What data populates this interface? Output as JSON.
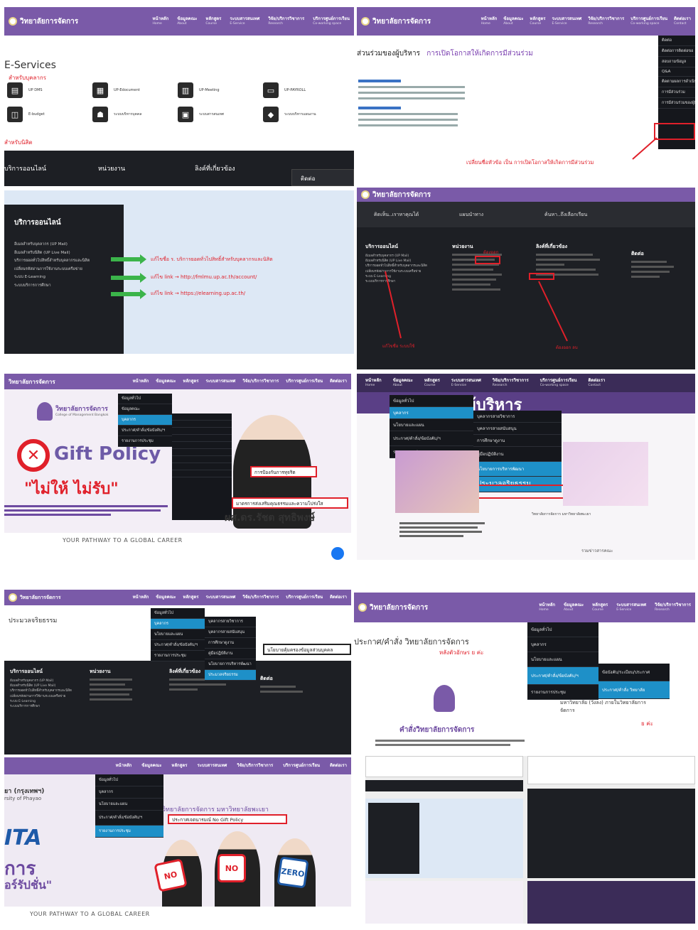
{
  "site": {
    "logo": "วิทยาลัยการจัดการ"
  },
  "nav": [
    {
      "th": "หน้าหลัก",
      "en": "Home"
    },
    {
      "th": "ข้อมูลคณะ",
      "en": "About"
    },
    {
      "th": "หลักสูตร",
      "en": "Course"
    },
    {
      "th": "ระบบสารสนเทศ",
      "en": "E-Service"
    },
    {
      "th": "วิจัย/บริการวิชาการ",
      "en": "Research"
    },
    {
      "th": "บริการศูนย์การเรียน",
      "en": "Co-working space"
    },
    {
      "th": "ติดต่อเรา",
      "en": "Contact"
    }
  ],
  "p1": {
    "title": "E-Services",
    "staff_label": "สำหรับบุคลากร",
    "student_label": "สำหรับนิสิต",
    "services": [
      "UP DMS",
      "UP-Edocument",
      "UP-Meeting",
      "UP-PAYROLL",
      "E-budget",
      "ระบบบริหารบุคคล",
      "ระบบสารสนเทศ",
      "ระบบบริหารแผนงาน"
    ],
    "footer": [
      "บริการออนไลน์",
      "หน่วยงาน",
      "ลิงค์ที่เกี่ยวข้อง",
      "ติดต่อ"
    ]
  },
  "p2": {
    "heading": "ส่วนร่วมของผู้บริหาร",
    "heading_accent": "การเปิดโอกาสให้เกิดการมีส่วนร่วม",
    "note": "เปลี่ยนชื่อหัวข้อ เป็น การเปิดโอกาสให้เกิดการมีส่วนร่วม",
    "menu": [
      "ติดต่อ",
      "ติดต่อการติดต่อขอ",
      "สอบถามข้อมูล",
      "Q&A",
      "ติดตามผลการดำเนินงาน",
      "การมีส่วนร่วม",
      "การมีส่วนร่วมของผู้มีส่วนได้"
    ]
  },
  "p3": {
    "title": "บริการออนไลน์",
    "items": [
      "อีเมลสำหรับบุคลากร (UP Mail)",
      "อีเมลสำหรับนิสิต (UP Live Mail)",
      "บริการยอดทั่วไปสิทธิ์สำหรับบุคลากรและนิสิต",
      "เปลี่ยนรหัสผ่านการใช้งานระบบเครือข่าย",
      "ระบบ E-Learning",
      "ระบบบริการการศึกษา"
    ],
    "fixes": [
      "แก้ไขชื่อ ร. บริการยอดทั่วไปสิทธิ์สำหรับบุคลากรและนิสิต",
      "แก้ไข link → http://fmlmu.up.ac.th/account/",
      "แก้ไข link → https://elearning.up.ac.th/"
    ]
  },
  "p4": {
    "tabs": [
      "คิดเห็น..เราหาคุณได้",
      "แผนนำทาง",
      "ค้นหา..ถึงเลือกเรียน"
    ],
    "cols": [
      "บริการออนไลน์",
      "หน่วยงาน",
      "ลิงค์ที่เกี่ยวข้อง",
      "ติดต่อ"
    ],
    "red_left": "แก้ไขชื่อ ระบบใช้",
    "red_right": "ต้องออก ลบ",
    "red_mid": "ต้องออก"
  },
  "p5": {
    "college_th": "วิทยาลัยการจัดการ",
    "college_sub": "College of Management Bangkok",
    "policy": "Gift Policy",
    "slogan": "\"ไม่ให้ ไม่รับ\"",
    "name": "ผศ.ดร.รัชต สุทธิพงษ์",
    "boxes": [
      "การป้องกันการทุจริต",
      "มาตรการส่งเสริมคุณธรรมและความโปร่งใส"
    ],
    "change_lbl": "เปลี่ยนชื่อ",
    "tagline": "YOUR PATHWAY TO A GLOBAL CAREER",
    "menu": [
      "ข้อมูลทั่วไป",
      "บุคลากร",
      "นโยบายและแผน",
      "ประกาศ/คำสั่ง/ข้อบังคับ/ฯ",
      "รายงานการประชุม"
    ]
  },
  "p6": {
    "banner": "ารงผู้บริหาร",
    "menu_l": [
      "ข้อมูลทั่วไป",
      "บุคลากร",
      "นโยบายและแผน",
      "ประกาศ/คำสั่ง/ข้อบังคับ/ฯ",
      "รายงานการประชุม"
    ],
    "menu_r": [
      "บุคลากรสายวิชาการ",
      "บุคลากรสายสนับสนุน",
      "การศึกษาดูงาน",
      "คู่มือปฏิบัติงาน",
      "นโยบายการบริหารพัฒนา",
      "ประมวลจริยธรรม"
    ],
    "news": "วิทยาลัยการจัดการ มหาวิทยาลัยพะเยา",
    "more": "รวมข่าวสารคณะ"
  },
  "p7": {
    "title": "ประมวลจริยธรรม",
    "box": "นโยบายคุ้มครองข้อมูลส่วนบุคคล",
    "cols": [
      "บริการออนไลน์",
      "หน่วยงาน",
      "ลิงค์ที่เกี่ยวข้อง",
      "ติดต่อ"
    ]
  },
  "p8": {
    "heading": "ประกาศ/คำสั่ง วิทยาลัยการจัดการ",
    "sub": "หลังตัวอักษร ย ค่ะ",
    "announce": "คำสั่งวิทยาลัยการจัดการ",
    "menu": [
      "ข้อมูลทั่วไป",
      "บุคลากร",
      "นโยบายและแผน",
      "ประกาศ/คำสั่ง/ข้อบังคับ/ฯ",
      "รายงานการประชุม"
    ],
    "submenu": [
      "ข้อบังคับ/ระเบียบ/ประกาศ",
      "ประกาศ/คำสั่ง วิทยาลัย"
    ],
    "side": "มหาวิทยาลัย (วังลง) ภายในวิทยาลัยการจัดการ",
    "side_red": "ย ค่ะ"
  },
  "p9": {
    "college": "วิทยาลัยการจัดการ มหาวิทยาลัยพะเยา",
    "box": "ประกาศเจตนารมณ์ No Gift Policy",
    "left1": "ยา (กรุงเทพฯ)",
    "left2": "rsity of Phayao",
    "ita": "ITA",
    "kan": "การ",
    "corr": "อร์รัปชั่น\"",
    "tagline": "YOUR PATHWAY TO A GLOBAL CAREER",
    "menu": [
      "ข้อมูลทั่วไป",
      "บุคลากร",
      "นโยบายและแผน",
      "ประกาศ/คำสั่ง/ข้อบังคับ/ฯ",
      "รายงานการประชุม"
    ]
  }
}
